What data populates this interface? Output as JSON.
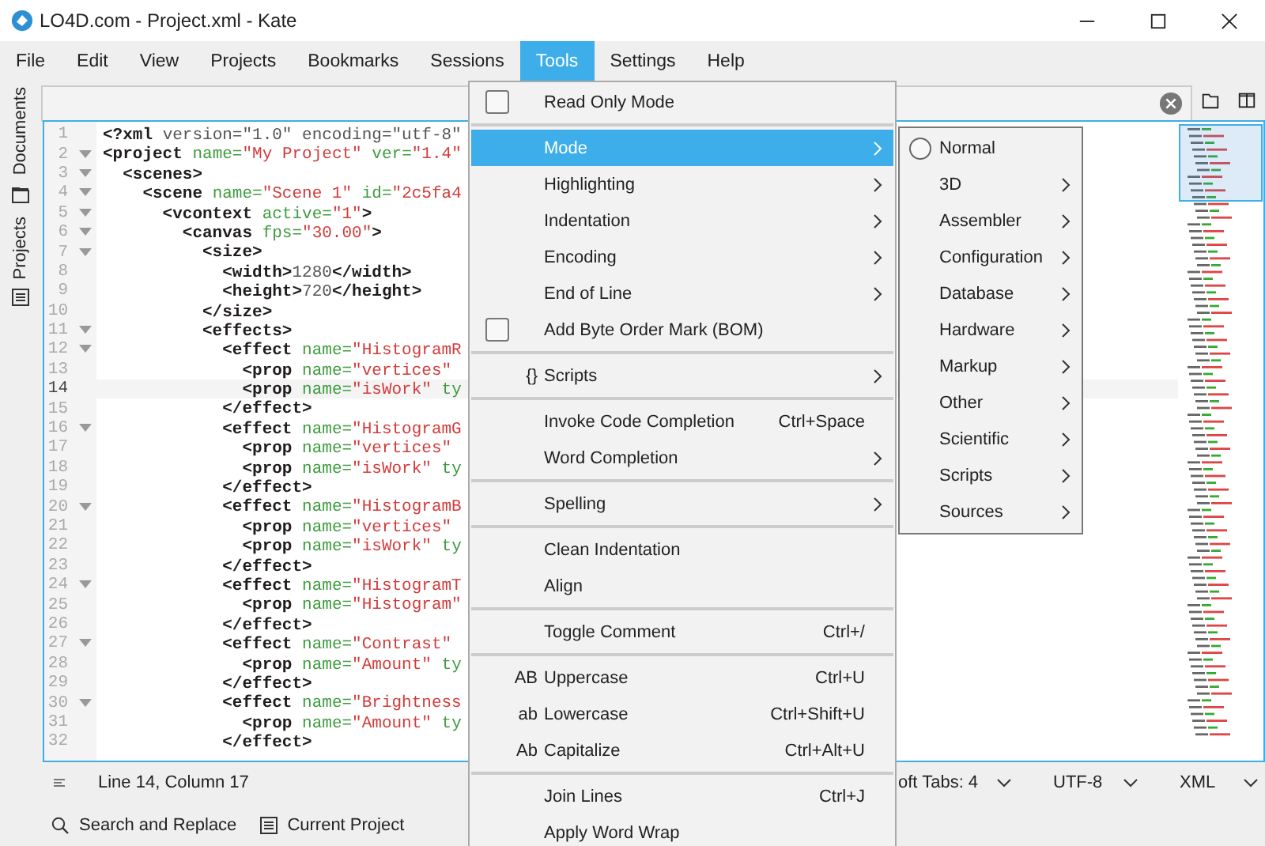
{
  "window": {
    "title": "LO4D.com - Project.xml  - Kate"
  },
  "menubar": [
    {
      "label": "File",
      "selected": false
    },
    {
      "label": "Edit",
      "selected": false
    },
    {
      "label": "View",
      "selected": false
    },
    {
      "label": "Projects",
      "selected": false
    },
    {
      "label": "Bookmarks",
      "selected": false
    },
    {
      "label": "Sessions",
      "selected": false
    },
    {
      "label": "Tools",
      "selected": true
    },
    {
      "label": "Settings",
      "selected": false
    },
    {
      "label": "Help",
      "selected": false
    }
  ],
  "sidebar": [
    {
      "label": "Documents"
    },
    {
      "label": "Projects"
    }
  ],
  "editor": {
    "lines": [
      {
        "n": "1",
        "fold": false,
        "current": false,
        "tokens": [
          {
            "kind": "tag",
            "text": "<?xml"
          },
          {
            "kind": "pi",
            "text": " version=\"1.0\" encoding=\"utf-8\""
          }
        ]
      },
      {
        "n": "2",
        "fold": true,
        "current": false,
        "tokens": [
          {
            "kind": "tag",
            "text": "<project"
          },
          {
            "kind": "attr",
            "text": " name="
          },
          {
            "kind": "val",
            "text": "\"My Project\""
          },
          {
            "kind": "attr",
            "text": " ver="
          },
          {
            "kind": "val",
            "text": "\"1.4\""
          }
        ]
      },
      {
        "n": "3",
        "fold": true,
        "current": false,
        "tokens": [
          {
            "kind": "tag",
            "text": "  <scenes>"
          }
        ]
      },
      {
        "n": "4",
        "fold": true,
        "current": false,
        "tokens": [
          {
            "kind": "tag",
            "text": "    <scene"
          },
          {
            "kind": "attr",
            "text": " name="
          },
          {
            "kind": "val",
            "text": "\"Scene 1\""
          },
          {
            "kind": "attr",
            "text": " id="
          },
          {
            "kind": "val",
            "text": "\"2c5fa4"
          }
        ]
      },
      {
        "n": "5",
        "fold": true,
        "current": false,
        "tokens": [
          {
            "kind": "tag",
            "text": "      <vcontext"
          },
          {
            "kind": "attr",
            "text": " active="
          },
          {
            "kind": "val",
            "text": "\"1\""
          },
          {
            "kind": "tag",
            "text": ">"
          }
        ]
      },
      {
        "n": "6",
        "fold": true,
        "current": false,
        "tokens": [
          {
            "kind": "tag",
            "text": "        <canvas"
          },
          {
            "kind": "attr",
            "text": " fps="
          },
          {
            "kind": "val",
            "text": "\"30.00\""
          },
          {
            "kind": "tag",
            "text": ">"
          }
        ]
      },
      {
        "n": "7",
        "fold": true,
        "current": false,
        "tokens": [
          {
            "kind": "tag",
            "text": "          <size>"
          }
        ]
      },
      {
        "n": "8",
        "fold": false,
        "current": false,
        "tokens": [
          {
            "kind": "tag",
            "text": "            <width>"
          },
          {
            "kind": "pi",
            "text": "1280"
          },
          {
            "kind": "tag",
            "text": "</width>"
          }
        ]
      },
      {
        "n": "9",
        "fold": false,
        "current": false,
        "tokens": [
          {
            "kind": "tag",
            "text": "            <height>"
          },
          {
            "kind": "pi",
            "text": "720"
          },
          {
            "kind": "tag",
            "text": "</height>"
          }
        ]
      },
      {
        "n": "10",
        "fold": false,
        "current": false,
        "tokens": [
          {
            "kind": "tag",
            "text": "          </size>"
          }
        ]
      },
      {
        "n": "11",
        "fold": true,
        "current": false,
        "tokens": [
          {
            "kind": "tag",
            "text": "          <effects>"
          }
        ]
      },
      {
        "n": "12",
        "fold": true,
        "current": false,
        "tokens": [
          {
            "kind": "tag",
            "text": "            <effect"
          },
          {
            "kind": "attr",
            "text": " name="
          },
          {
            "kind": "val",
            "text": "\"HistogramR"
          }
        ]
      },
      {
        "n": "13",
        "fold": false,
        "current": false,
        "tokens": [
          {
            "kind": "tag",
            "text": "              <prop"
          },
          {
            "kind": "attr",
            "text": " name="
          },
          {
            "kind": "val",
            "text": "\"vertices\""
          }
        ]
      },
      {
        "n": "14",
        "fold": false,
        "current": true,
        "tokens": [
          {
            "kind": "tag",
            "text": "              <prop"
          },
          {
            "kind": "attr",
            "text": " name="
          },
          {
            "kind": "val",
            "text": "\"isWork\""
          },
          {
            "kind": "attr",
            "text": " ty"
          }
        ]
      },
      {
        "n": "15",
        "fold": false,
        "current": false,
        "tokens": [
          {
            "kind": "tag",
            "text": "            </effect>"
          }
        ]
      },
      {
        "n": "16",
        "fold": true,
        "current": false,
        "tokens": [
          {
            "kind": "tag",
            "text": "            <effect"
          },
          {
            "kind": "attr",
            "text": " name="
          },
          {
            "kind": "val",
            "text": "\"HistogramG"
          }
        ]
      },
      {
        "n": "17",
        "fold": false,
        "current": false,
        "tokens": [
          {
            "kind": "tag",
            "text": "              <prop"
          },
          {
            "kind": "attr",
            "text": " name="
          },
          {
            "kind": "val",
            "text": "\"vertices\""
          }
        ]
      },
      {
        "n": "18",
        "fold": false,
        "current": false,
        "tokens": [
          {
            "kind": "tag",
            "text": "              <prop"
          },
          {
            "kind": "attr",
            "text": " name="
          },
          {
            "kind": "val",
            "text": "\"isWork\""
          },
          {
            "kind": "attr",
            "text": " ty"
          }
        ]
      },
      {
        "n": "19",
        "fold": false,
        "current": false,
        "tokens": [
          {
            "kind": "tag",
            "text": "            </effect>"
          }
        ]
      },
      {
        "n": "20",
        "fold": true,
        "current": false,
        "tokens": [
          {
            "kind": "tag",
            "text": "            <effect"
          },
          {
            "kind": "attr",
            "text": " name="
          },
          {
            "kind": "val",
            "text": "\"HistogramB"
          }
        ]
      },
      {
        "n": "21",
        "fold": false,
        "current": false,
        "tokens": [
          {
            "kind": "tag",
            "text": "              <prop"
          },
          {
            "kind": "attr",
            "text": " name="
          },
          {
            "kind": "val",
            "text": "\"vertices\""
          }
        ]
      },
      {
        "n": "22",
        "fold": false,
        "current": false,
        "tokens": [
          {
            "kind": "tag",
            "text": "              <prop"
          },
          {
            "kind": "attr",
            "text": " name="
          },
          {
            "kind": "val",
            "text": "\"isWork\""
          },
          {
            "kind": "attr",
            "text": " ty"
          }
        ]
      },
      {
        "n": "23",
        "fold": false,
        "current": false,
        "tokens": [
          {
            "kind": "tag",
            "text": "            </effect>"
          }
        ]
      },
      {
        "n": "24",
        "fold": true,
        "current": false,
        "tokens": [
          {
            "kind": "tag",
            "text": "            <effect"
          },
          {
            "kind": "attr",
            "text": " name="
          },
          {
            "kind": "val",
            "text": "\"HistogramT"
          }
        ]
      },
      {
        "n": "25",
        "fold": false,
        "current": false,
        "tokens": [
          {
            "kind": "tag",
            "text": "              <prop"
          },
          {
            "kind": "attr",
            "text": " name="
          },
          {
            "kind": "val",
            "text": "\"Histogram\""
          }
        ]
      },
      {
        "n": "26",
        "fold": false,
        "current": false,
        "tokens": [
          {
            "kind": "tag",
            "text": "            </effect>"
          }
        ]
      },
      {
        "n": "27",
        "fold": true,
        "current": false,
        "tokens": [
          {
            "kind": "tag",
            "text": "            <effect"
          },
          {
            "kind": "attr",
            "text": " name="
          },
          {
            "kind": "val",
            "text": "\"Contrast\""
          }
        ]
      },
      {
        "n": "28",
        "fold": false,
        "current": false,
        "tokens": [
          {
            "kind": "tag",
            "text": "              <prop"
          },
          {
            "kind": "attr",
            "text": " name="
          },
          {
            "kind": "val",
            "text": "\"Amount\""
          },
          {
            "kind": "attr",
            "text": " ty"
          }
        ]
      },
      {
        "n": "29",
        "fold": false,
        "current": false,
        "tokens": [
          {
            "kind": "tag",
            "text": "            </effect>"
          }
        ]
      },
      {
        "n": "30",
        "fold": true,
        "current": false,
        "tokens": [
          {
            "kind": "tag",
            "text": "            <effect"
          },
          {
            "kind": "attr",
            "text": " name="
          },
          {
            "kind": "val",
            "text": "\"Brightness"
          }
        ]
      },
      {
        "n": "31",
        "fold": false,
        "current": false,
        "tokens": [
          {
            "kind": "tag",
            "text": "              <prop"
          },
          {
            "kind": "attr",
            "text": " name="
          },
          {
            "kind": "val",
            "text": "\"Amount\""
          },
          {
            "kind": "attr",
            "text": " ty"
          }
        ]
      },
      {
        "n": "32",
        "fold": false,
        "current": false,
        "tokens": [
          {
            "kind": "tag",
            "text": "            </effect>"
          }
        ]
      }
    ]
  },
  "status_bar": {
    "position": "Line 14, Column 17",
    "indent": "oft Tabs: 4",
    "encoding": "UTF-8",
    "mode": "XML"
  },
  "bottom_tabs": [
    {
      "label": "Search and Replace"
    },
    {
      "label": "Current Project"
    }
  ],
  "tools_menu": [
    {
      "kind": "check",
      "label": "Read Only Mode",
      "checked": false,
      "selected": false
    },
    {
      "kind": "separator"
    },
    {
      "kind": "submenu",
      "label": "Mode",
      "selected": true
    },
    {
      "kind": "submenu",
      "label": "Highlighting",
      "selected": false
    },
    {
      "kind": "submenu",
      "label": "Indentation",
      "selected": false
    },
    {
      "kind": "submenu",
      "label": "Encoding",
      "selected": false
    },
    {
      "kind": "submenu",
      "label": "End of Line",
      "selected": false
    },
    {
      "kind": "check",
      "label": "Add Byte Order Mark (BOM)",
      "checked": false,
      "selected": false
    },
    {
      "kind": "separator"
    },
    {
      "kind": "submenu",
      "label": "Scripts",
      "icon": "{}",
      "selected": false
    },
    {
      "kind": "separator"
    },
    {
      "kind": "action",
      "label": "Invoke Code Completion",
      "shortcut": "Ctrl+Space",
      "selected": false
    },
    {
      "kind": "submenu",
      "label": "Word Completion",
      "selected": false
    },
    {
      "kind": "separator"
    },
    {
      "kind": "submenu",
      "label": "Spelling",
      "selected": false
    },
    {
      "kind": "separator"
    },
    {
      "kind": "action",
      "label": "Clean Indentation",
      "selected": false
    },
    {
      "kind": "action",
      "label": "Align",
      "selected": false
    },
    {
      "kind": "separator"
    },
    {
      "kind": "action",
      "label": "Toggle Comment",
      "shortcut": "Ctrl+/",
      "selected": false
    },
    {
      "kind": "separator"
    },
    {
      "kind": "action",
      "label": "Uppercase",
      "icon": "AB",
      "shortcut": "Ctrl+U",
      "selected": false
    },
    {
      "kind": "action",
      "label": "Lowercase",
      "icon": "ab",
      "shortcut": "Ctrl+Shift+U",
      "selected": false
    },
    {
      "kind": "action",
      "label": "Capitalize",
      "icon": "Ab",
      "shortcut": "Ctrl+Alt+U",
      "selected": false
    },
    {
      "kind": "separator"
    },
    {
      "kind": "action",
      "label": "Join Lines",
      "shortcut": "Ctrl+J",
      "selected": false
    },
    {
      "kind": "action",
      "label": "Apply Word Wrap",
      "selected": false
    }
  ],
  "mode_submenu": [
    {
      "kind": "radio",
      "label": "Normal",
      "checked": false,
      "selected": false
    },
    {
      "kind": "submenu",
      "label": "3D",
      "selected": false
    },
    {
      "kind": "submenu",
      "label": "Assembler",
      "selected": false
    },
    {
      "kind": "submenu",
      "label": "Configuration",
      "selected": false
    },
    {
      "kind": "submenu",
      "label": "Database",
      "selected": false
    },
    {
      "kind": "submenu",
      "label": "Hardware",
      "selected": false
    },
    {
      "kind": "submenu",
      "label": "Markup",
      "selected": false
    },
    {
      "kind": "submenu",
      "label": "Other",
      "selected": false
    },
    {
      "kind": "submenu",
      "label": "Scientific",
      "selected": false
    },
    {
      "kind": "submenu",
      "label": "Scripts",
      "selected": false
    },
    {
      "kind": "submenu",
      "label": "Sources",
      "selected": false
    }
  ]
}
